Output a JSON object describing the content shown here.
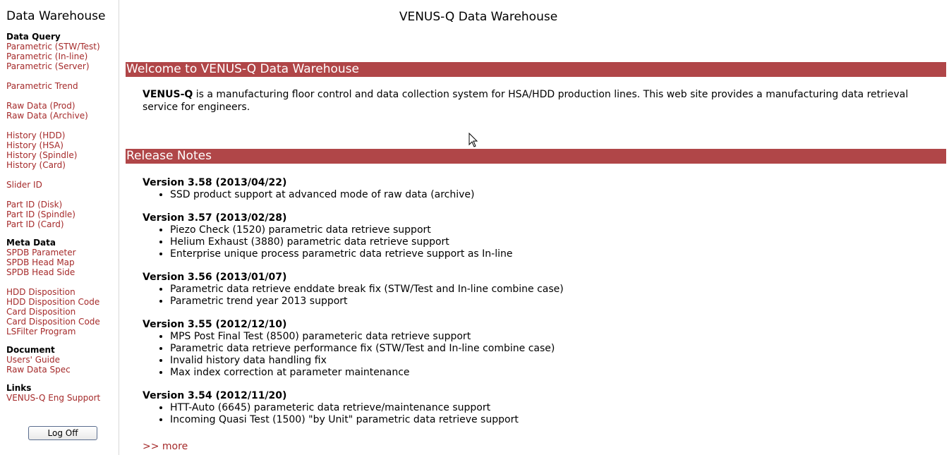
{
  "sidebar": {
    "title": "Data Warehouse",
    "groups": [
      {
        "heading": "Data Query",
        "links": [
          "Parametric (STW/Test)",
          "Parametric (In-line)",
          "Parametric (Server)",
          "",
          "Parametric Trend",
          "",
          "Raw Data (Prod)",
          "Raw Data (Archive)",
          "",
          "History (HDD)",
          "History (HSA)",
          "History (Spindle)",
          "History (Card)",
          "",
          "Slider ID",
          "",
          "Part ID (Disk)",
          "Part ID (Spindle)",
          "Part ID (Card)"
        ]
      },
      {
        "heading": "Meta Data",
        "links": [
          "SPDB Parameter",
          "SPDB Head Map",
          "SPDB Head Side",
          "",
          "HDD Disposition",
          "HDD Disposition Code",
          "Card Disposition",
          "Card Disposition Code",
          "LSFilter Program"
        ]
      },
      {
        "heading": "Document",
        "links": [
          "Users' Guide",
          "Raw Data Spec"
        ]
      },
      {
        "heading": "Links",
        "links": [
          "VENUS-Q Eng Support"
        ]
      }
    ],
    "logoff_label": "Log Off"
  },
  "main": {
    "page_title": "VENUS-Q Data Warehouse",
    "welcome_bar": "Welcome to VENUS-Q Data Warehouse",
    "intro_bold": "VENUS-Q",
    "intro_text": " is a manufacturing floor control and data collection system for HSA/HDD production lines. This web site provides a manufacturing data retrieval service for engineers.",
    "release_bar": "Release Notes",
    "releases": [
      {
        "version": "Version 3.58 (2013/04/22)",
        "notes": [
          "SSD product support at advanced mode of raw data (archive)"
        ]
      },
      {
        "version": "Version 3.57 (2013/02/28)",
        "notes": [
          "Piezo Check (1520) parametric data retrieve support",
          "Helium Exhaust (3880) parametric data retrieve support",
          "Enterprise unique process parametric data retrieve support as In-line"
        ]
      },
      {
        "version": "Version 3.56 (2013/01/07)",
        "notes": [
          "Parametric data retrieve enddate break fix (STW/Test and In-line combine case)",
          "Parametric trend year 2013 support"
        ]
      },
      {
        "version": "Version 3.55 (2012/12/10)",
        "notes": [
          "MPS Post Final Test (8500) parameteric data retrieve support",
          "Parametric data retrieve performance fix (STW/Test and In-line combine case)",
          "Invalid history data handling fix",
          "Max index correction at parameter maintenance"
        ]
      },
      {
        "version": "Version 3.54 (2012/11/20)",
        "notes": [
          "HTT-Auto (6645) parameteric data retrieve/maintenance support",
          "Incoming Quasi Test (1500) \"by Unit\" parametric data retrieve support"
        ]
      }
    ],
    "more_link": ">> more"
  },
  "colors": {
    "accent_bar": "#b04648",
    "link": "#a52a2a"
  },
  "cursor_icon": "mouse-pointer-icon"
}
